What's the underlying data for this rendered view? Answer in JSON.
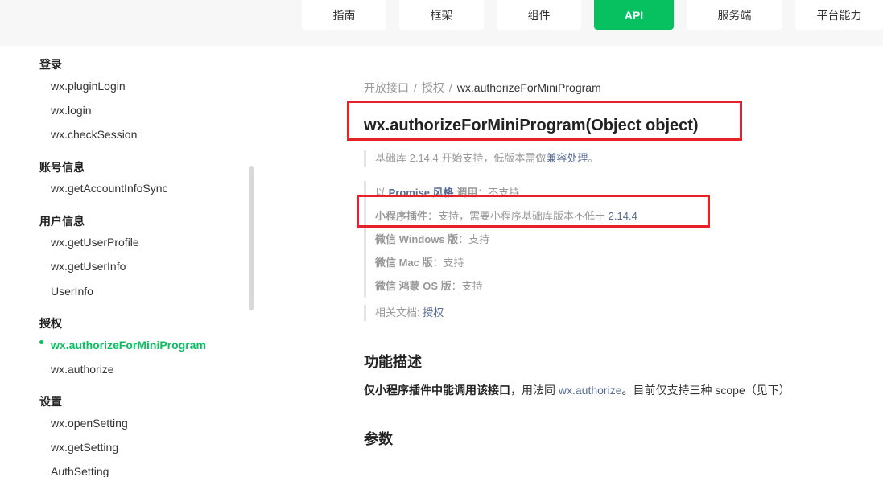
{
  "nav": {
    "tabs": [
      {
        "label": "指南"
      },
      {
        "label": "框架"
      },
      {
        "label": "组件"
      },
      {
        "label": "API"
      },
      {
        "label": "服务端"
      },
      {
        "label": "平台能力"
      }
    ],
    "active_color": "#07c160"
  },
  "sidebar": {
    "groups": [
      {
        "label": "登录",
        "items": [
          "wx.pluginLogin",
          "wx.login",
          "wx.checkSession"
        ]
      },
      {
        "label": "账号信息",
        "items": [
          "wx.getAccountInfoSync"
        ]
      },
      {
        "label": "用户信息",
        "items": [
          "wx.getUserProfile",
          "wx.getUserInfo",
          "UserInfo"
        ]
      },
      {
        "label": "授权",
        "items": [
          "wx.authorizeForMiniProgram",
          "wx.authorize"
        ]
      },
      {
        "label": "设置",
        "items": [
          "wx.openSetting",
          "wx.getSetting",
          "AuthSetting"
        ]
      }
    ],
    "active_item": "wx.authorizeForMiniProgram"
  },
  "breadcrumb": {
    "items": [
      "开放接口",
      "授权",
      "wx.authorizeForMiniProgram"
    ]
  },
  "title": "wx.authorizeForMiniProgram(Object object)",
  "support": {
    "base_lib_prefix": "基础库 2.14.4 开始支持，低版本需做",
    "compat_link": "兼容处理",
    "base_lib_suffix": "。",
    "promise_prefix": "以",
    "promise_link": "Promise 风格",
    "promise_middle": "调用",
    "promise_value": "：不支持",
    "plugin_label": "小程序插件",
    "plugin_value": "：支持，需要小程序基础库版本不低于",
    "plugin_version": "2.14.4",
    "windows_label": "微信 Windows 版",
    "windows_value": "：支持",
    "mac_label": "微信 Mac 版",
    "mac_value": "：支持",
    "harmony_label": "微信 鸿蒙 OS 版",
    "harmony_value": "：支持",
    "related_prefix": "相关文档: ",
    "related_link": "授权"
  },
  "section_desc": {
    "heading": "功能描述",
    "bold_text": "仅小程序插件中能调用该接口",
    "middle_text": "，用法同 ",
    "link": "wx.authorize",
    "suffix": "。目前仅支持三种 scope（见下）"
  },
  "section_params": {
    "heading": "参数"
  },
  "colors": {
    "accent": "#07c160",
    "link": "#576b95",
    "highlight_box": "#e8202a"
  }
}
